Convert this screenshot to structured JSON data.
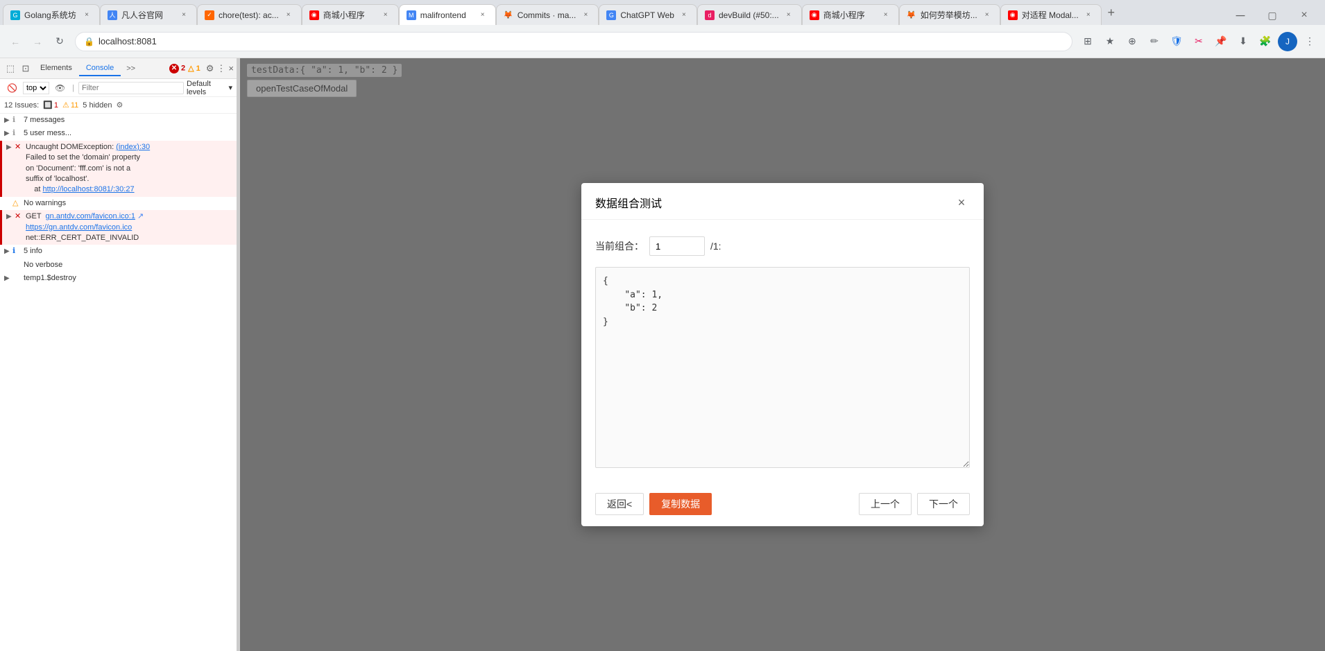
{
  "browser": {
    "tabs": [
      {
        "id": 1,
        "favicon": "G",
        "favicon_color": "#00ACD7",
        "title": "Golang系统坊",
        "active": false
      },
      {
        "id": 2,
        "favicon": "人",
        "favicon_color": "#4285f4",
        "title": "凡人谷官网",
        "active": false
      },
      {
        "id": 3,
        "favicon": "✓",
        "favicon_color": "#ff6600",
        "title": "chore(test): ac...",
        "active": false
      },
      {
        "id": 4,
        "favicon": "◉",
        "favicon_color": "#f00",
        "title": "商城小程序",
        "active": false
      },
      {
        "id": 5,
        "favicon": "M",
        "favicon_color": "#4285f4",
        "title": "malifrontend",
        "active": true
      },
      {
        "id": 6,
        "favicon": "🦊",
        "favicon_color": "#ff6600",
        "title": "Commits · ma...",
        "active": false
      },
      {
        "id": 7,
        "favicon": "G",
        "favicon_color": "#4285f4",
        "title": "ChatGPT Web",
        "active": false
      },
      {
        "id": 8,
        "favicon": "d",
        "favicon_color": "#e91e63",
        "title": "devBuild (#50:...",
        "active": false
      },
      {
        "id": 9,
        "favicon": "◉",
        "favicon_color": "#f00",
        "title": "商城小程序",
        "active": false
      },
      {
        "id": 10,
        "favicon": "🦊",
        "favicon_color": "#ff6600",
        "title": "如何劳举模坊...",
        "active": false
      },
      {
        "id": 11,
        "favicon": "◉",
        "favicon_color": "#f00",
        "title": "对适程 Modal...",
        "active": false
      }
    ],
    "url": "localhost:8081"
  },
  "devtools": {
    "tabs": [
      "Elements",
      "Console",
      ">>"
    ],
    "active_tab": "Console",
    "error_count": "2",
    "warning_count": "1",
    "issues_count": "12",
    "issues_err": "1",
    "issues_warn": "11",
    "hidden_count": "5",
    "filter_placeholder": "Filter",
    "default_levels": "Default levels",
    "console_groups": [
      {
        "type": "group",
        "count": "7 messages",
        "icon": "▶"
      },
      {
        "type": "group",
        "count": "5 user mess...",
        "icon": "▶"
      },
      {
        "type": "error",
        "icon": "✕",
        "text": "Uncaught DOMException:",
        "link": "(index):30",
        "detail1": "Failed to set the 'domain' property",
        "detail2": "on 'Document': 'fff.com' is not a",
        "detail3": "suffix of 'localhost'.",
        "at": "at",
        "at_link": "http://localhost:8081/:30:27"
      },
      {
        "type": "no-warnings",
        "icon": "△",
        "text": "No warnings"
      },
      {
        "type": "get-error",
        "icon": "✕",
        "text": "GET",
        "link": "gn.antdv.com/favicon.ico:1",
        "link2": "https://gn.antdv.com/favicon.ico",
        "detail": "net::ERR_CERT_DATE_INVALID"
      },
      {
        "type": "info",
        "icon": "ℹ",
        "count": "5 info"
      },
      {
        "type": "no-verbose",
        "icon": "",
        "text": "No verbose"
      },
      {
        "type": "code",
        "text": "temp1.$destroy"
      }
    ]
  },
  "page": {
    "console_line1": "testData:{ \"a\": 1, \"b\": 2 }",
    "open_button": "openTestCaseOfModal"
  },
  "modal": {
    "title": "数据组合测试",
    "close_label": "×",
    "combination_label": "当前组合：",
    "combination_value": "1",
    "combination_separator": "/1:",
    "textarea_content": "{\n    \"a\": 1,\n    \"b\": 2\n}",
    "back_button": "返回<",
    "copy_button": "复制数据",
    "prev_button": "上一个",
    "next_button": "下一个"
  }
}
